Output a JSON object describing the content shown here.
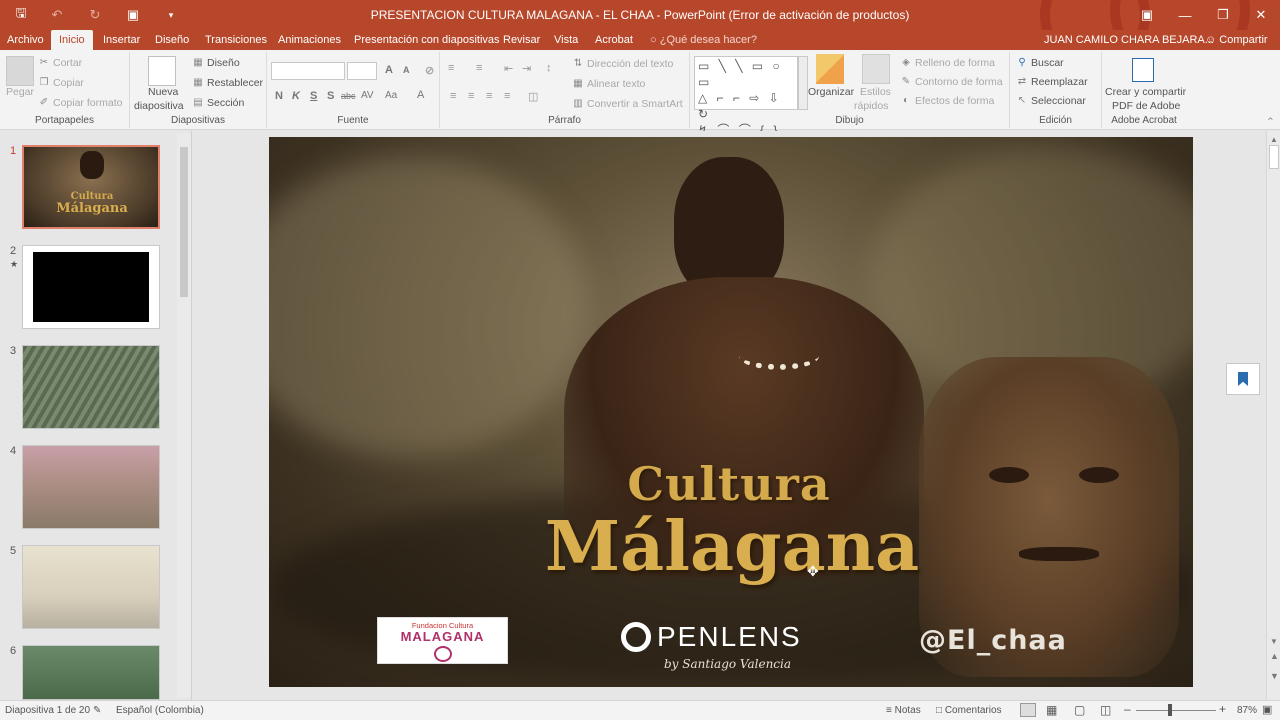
{
  "window": {
    "title": "PRESENTACION CULTURA MALAGANA - EL CHAA - PowerPoint (Error de activación de productos)",
    "user": "JUAN CAMILO CHARA BEJARA...",
    "share_label": "Compartir"
  },
  "tabs": [
    "Archivo",
    "Inicio",
    "Insertar",
    "Diseño",
    "Transiciones",
    "Animaciones",
    "Presentación con diapositivas",
    "Revisar",
    "Vista",
    "Acrobat"
  ],
  "tell_me": "¿Qué desea hacer?",
  "ribbon": {
    "portapapeles": {
      "label": "Portapapeles",
      "pegar": "Pegar",
      "cortar": "Cortar",
      "copiar": "Copiar",
      "copiar_formato": "Copiar formato"
    },
    "diapositivas": {
      "label": "Diapositivas",
      "nueva_1": "Nueva",
      "nueva_2": "diapositiva",
      "diseno": "Diseño",
      "restablecer": "Restablecer",
      "seccion": "Sección"
    },
    "fuente": {
      "label": "Fuente",
      "bold": "N",
      "italic": "K",
      "underline": "S",
      "shadow": "S",
      "strike": "abc",
      "spacing": "AV",
      "case": "Aa",
      "color": "A",
      "grow": "A",
      "shrink": "A"
    },
    "parrafo": {
      "label": "Párrafo",
      "direccion": "Dirección del texto",
      "alinear": "Alinear texto",
      "smartart": "Convertir a SmartArt"
    },
    "dibujo": {
      "label": "Dibujo",
      "organizar": "Organizar",
      "estilos_1": "Estilos",
      "estilos_2": "rápidos",
      "relleno": "Relleno de forma",
      "contorno": "Contorno de forma",
      "efectos": "Efectos de forma"
    },
    "edicion": {
      "label": "Edición",
      "buscar": "Buscar",
      "reemplazar": "Reemplazar",
      "seleccionar": "Seleccionar"
    },
    "acrobat": {
      "label": "Adobe Acrobat",
      "crear_1": "Crear y compartir",
      "crear_2": "PDF de Adobe"
    }
  },
  "thumbnails": [
    {
      "num": "1",
      "kind": "title"
    },
    {
      "num": "2",
      "kind": "black",
      "star": "★"
    },
    {
      "num": "3",
      "kind": "aerial"
    },
    {
      "num": "4",
      "kind": "crowd"
    },
    {
      "num": "5",
      "kind": "field"
    },
    {
      "num": "6",
      "kind": "people"
    }
  ],
  "slide": {
    "title_line1": "Cultura",
    "title_line2": "Málagana",
    "fund_top": "Fundacion Cultura",
    "fund_main": "MALAGANA",
    "penlens": "PENLENS",
    "penlens_sub": "by Santiago Valencia",
    "handle": "@El_chaa"
  },
  "status": {
    "slide_info": "Diapositiva 1 de 20",
    "language": "Español (Colombia)",
    "notas": "Notas",
    "comentarios": "Comentarios",
    "zoom": "87%"
  },
  "colors": {
    "accent": "#b7472a",
    "title_gold": "#d4aa4c"
  }
}
